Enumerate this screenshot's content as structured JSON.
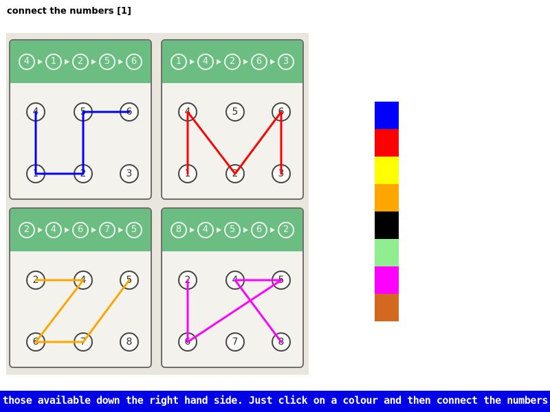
{
  "title": "connect the numbers [1]",
  "puzzles": [
    {
      "sequence": [
        "4",
        "1",
        "2",
        "5",
        "6"
      ],
      "dots": [
        [
          "4",
          "5",
          "6"
        ],
        [
          "1",
          "2",
          "3"
        ]
      ],
      "line_color": "#0000ff"
    },
    {
      "sequence": [
        "1",
        "4",
        "2",
        "6",
        "3"
      ],
      "dots": [
        [
          "4",
          "5",
          "6"
        ],
        [
          "1",
          "2",
          "3"
        ]
      ],
      "line_color": "#ff0000"
    },
    {
      "sequence": [
        "2",
        "4",
        "6",
        "7",
        "5"
      ],
      "dots": [
        [
          "2",
          "4",
          "5"
        ],
        [
          "6",
          "7",
          "8"
        ]
      ],
      "line_color": "#ffa500"
    },
    {
      "sequence": [
        "8",
        "4",
        "5",
        "6",
        "2"
      ],
      "dots": [
        [
          "2",
          "4",
          "5"
        ],
        [
          "6",
          "7",
          "8"
        ]
      ],
      "line_color": "#ff00ff"
    }
  ],
  "palette": {
    "colors": [
      "#0000ff",
      "#ff0000",
      "#ffff00",
      "#ffa500",
      "#000000",
      "#90ee90",
      "#ff00ff",
      "#d2691e"
    ],
    "names": [
      "blue",
      "red",
      "yellow",
      "orange",
      "black",
      "light-green",
      "magenta",
      "brown"
    ]
  },
  "instructions": "om those available down the right hand side. Just click on a colour and then connect the numbers. To r",
  "instruction_bar_color": "#0000e6"
}
